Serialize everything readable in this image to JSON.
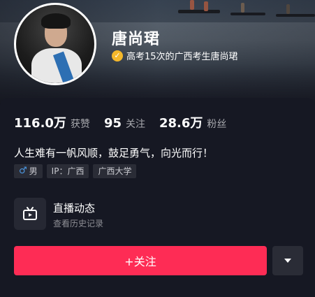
{
  "profile": {
    "name": "唐尚珺",
    "verified_text": "高考15次的广西考生唐尚珺",
    "bio": "人生难有一帆风顺，鼓足勇气，向光而行！"
  },
  "stats": {
    "likes_value": "116.0万",
    "likes_label": "获赞",
    "following_value": "95",
    "following_label": "关注",
    "followers_value": "28.6万",
    "followers_label": "粉丝"
  },
  "tags": {
    "gender_icon": "♂",
    "gender": "男",
    "ip": "IP：广西",
    "school": "广西大学"
  },
  "live": {
    "title": "直播动态",
    "subtitle": "查看历史记录"
  },
  "actions": {
    "follow_label": "+关注"
  },
  "colors": {
    "accent": "#fe2c55",
    "background": "#161823",
    "verified": "#f5b82b",
    "male": "#4d9be8"
  },
  "icons": {
    "verified": "verified-badge-icon",
    "gender": "male-icon",
    "live": "tv-icon",
    "more": "caret-down-icon"
  }
}
